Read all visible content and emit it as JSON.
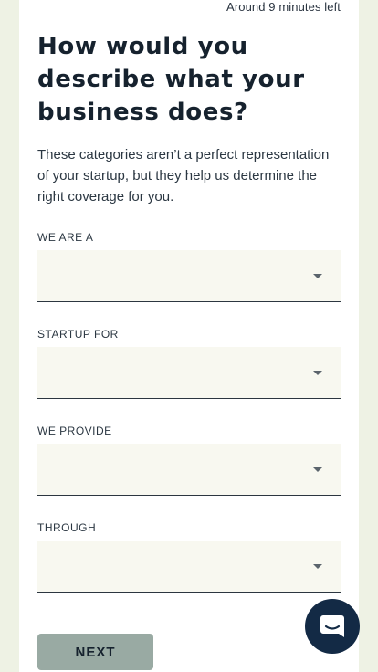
{
  "header": {
    "time_left": "Around 9 minutes left"
  },
  "main": {
    "heading": "How would you describe what your business does?",
    "description": "These categories aren’t a perfect representation of your startup, but they help us determine the right coverage for you."
  },
  "fields": [
    {
      "label": "WE ARE A",
      "value": ""
    },
    {
      "label": "STARTUP FOR",
      "value": ""
    },
    {
      "label": "WE PROVIDE",
      "value": ""
    },
    {
      "label": "THROUGH",
      "value": ""
    }
  ],
  "actions": {
    "next_label": "NEXT"
  },
  "chat": {
    "icon": "chat-bubble-icon"
  },
  "colors": {
    "page_background": "#eef2e4",
    "card_background": "#ffffff",
    "select_background": "#f8f8f0",
    "next_button": "#99aaa3",
    "chat_launcher": "#132a45",
    "text_primary": "#16222e"
  }
}
